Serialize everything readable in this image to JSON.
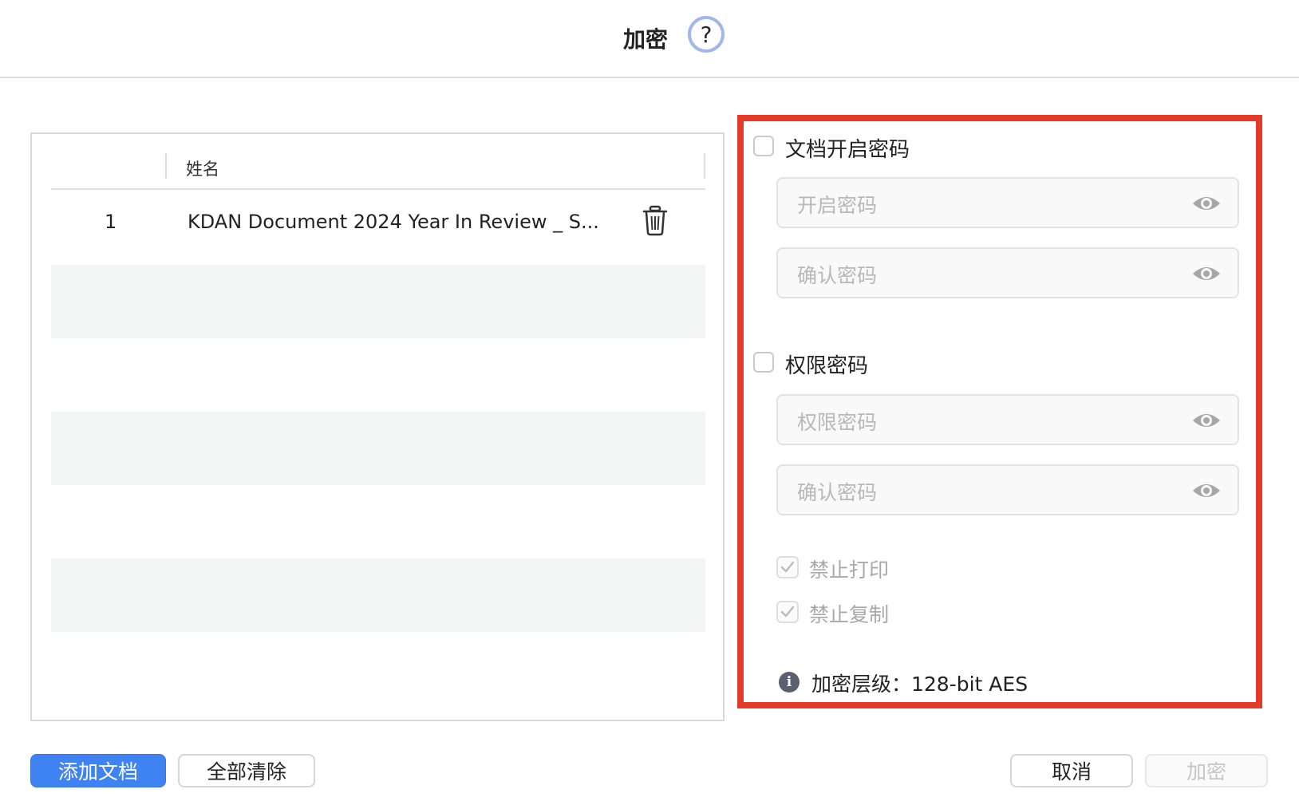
{
  "dialog": {
    "title": "加密",
    "help_icon": "question-icon",
    "help_glyph": "?"
  },
  "file_list": {
    "column_header": "姓名",
    "rows": [
      {
        "index": "1",
        "name": "KDAN Document 2024 Year In Review _ S...",
        "delete_icon": "trash-icon"
      }
    ]
  },
  "options": {
    "open_password": {
      "label": "文档开启密码",
      "checked": false,
      "fields": [
        {
          "placeholder": "开启密码",
          "icon": "eye-icon"
        },
        {
          "placeholder": "确认密码",
          "icon": "eye-icon"
        }
      ]
    },
    "permission_password": {
      "label": "权限密码",
      "checked": false,
      "fields": [
        {
          "placeholder": "权限密码",
          "icon": "eye-icon"
        },
        {
          "placeholder": "确认密码",
          "icon": "eye-icon"
        }
      ]
    },
    "restrictions": [
      {
        "label": "禁止打印",
        "checked": true,
        "disabled": true
      },
      {
        "label": "禁止复制",
        "checked": true,
        "disabled": true
      }
    ],
    "encryption_level": {
      "icon": "info-icon",
      "label": "加密层级：128-bit AES"
    }
  },
  "buttons": {
    "add_document": "添加文档",
    "clear_all": "全部清除",
    "cancel": "取消",
    "encrypt": "加密"
  },
  "colors": {
    "highlight_border": "#e33b28",
    "primary_button": "#3f83f2",
    "help_ring": "#9fb6ee"
  }
}
